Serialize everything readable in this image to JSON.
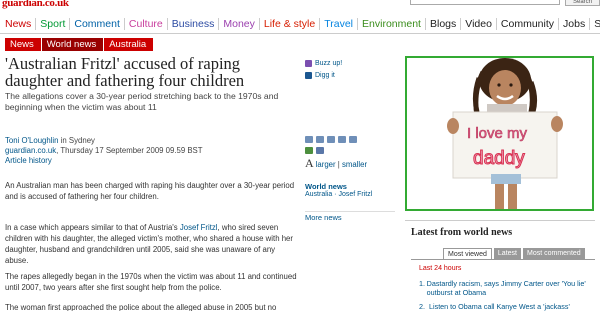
{
  "site": {
    "logo": "guardian.co.uk",
    "search_button": "Search"
  },
  "nav": [
    {
      "label": "News",
      "color": "#cc0000"
    },
    {
      "label": "Sport",
      "color": "#009933"
    },
    {
      "label": "Comment",
      "color": "#0061a6"
    },
    {
      "label": "Culture",
      "color": "#c83d9c"
    },
    {
      "label": "Business",
      "color": "#2c4ba3"
    },
    {
      "label": "Money",
      "color": "#9b3fae"
    },
    {
      "label": "Life & style",
      "color": "#d61d00"
    },
    {
      "label": "Travel",
      "color": "#0584e0"
    },
    {
      "label": "Environment",
      "color": "#3a8d1c"
    },
    {
      "label": "Blogs",
      "color": "#222222"
    },
    {
      "label": "Video",
      "color": "#222222"
    },
    {
      "label": "Community",
      "color": "#222222"
    },
    {
      "label": "Jobs",
      "color": "#222222"
    },
    {
      "label": "Shop",
      "color": "#222222"
    }
  ],
  "breadcrumb": [
    "News",
    "World news",
    "Australia"
  ],
  "article": {
    "headline": "'Australian Fritzl' accused of raping daughter and fathering four children",
    "standfirst": "The allegations cover a 30-year period stretching back to the 1970s and beginning when the victim was about 11",
    "author": "Toni O'Loughlin",
    "location": "in Sydney",
    "source": "guardian.co.uk",
    "date": ", Thursday 17 September 2009 09.59 BST",
    "history": "Article history",
    "p1": "An Australian man has been charged with raping his daughter over a 30-year period and is accused of fathering her four children.",
    "p2_a": "In a case which appears similar to that of Austria's ",
    "p2_link": "Josef Fritzl",
    "p2_b": ", who sired seven children with his daughter, the alleged victim's mother, who shared a house with her daughter, husband and grandchildren until 2005, said she was unaware of any abuse.",
    "p3": "The rapes allegedly began in the 1970s when the victim was about 11 and continued until 2007, two years after she first sought help from the police.",
    "p4": "The woman first approached the police about the alleged abuse in 2005 but no"
  },
  "social": {
    "buzz": "Buzz up!",
    "digg": "Digg it",
    "larger": "larger",
    "sep": " | ",
    "smaller": "smaller",
    "font_A": "A"
  },
  "related": {
    "heading": "World news",
    "item1": "Australia",
    "item_sep": " · ",
    "item2": "Josef Fritzl",
    "more": "More news"
  },
  "picture": {
    "sign_line1": "I love my",
    "sign_line2": "daddy"
  },
  "world_news": {
    "title": "Latest from world news",
    "tabs": [
      "Most viewed",
      "Latest",
      "Most commented"
    ],
    "last24": "Last 24 hours",
    "items": [
      {
        "num": "1.",
        "text": "Dastardly racism, says Jimmy Carter over 'You lie' outburst at Obama"
      },
      {
        "num": "2.",
        "text": "Listen to Obama call Kanye West a 'jackass'"
      }
    ]
  },
  "colors": {
    "brand_red": "#cc0000",
    "link_blue": "#005689",
    "picture_border": "#33aa33"
  }
}
